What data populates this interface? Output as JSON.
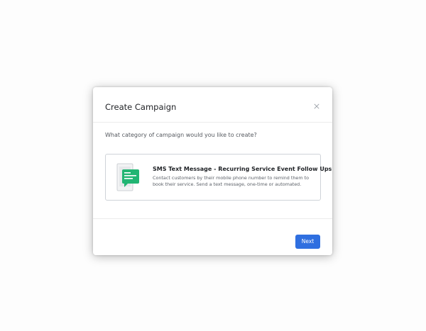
{
  "modal": {
    "title": "Create Campaign",
    "close_icon": "close-icon",
    "question": "What category of campaign would you like to create?",
    "options": [
      {
        "icon": "sms-message-icon",
        "icon_color": "#22b573",
        "title": "SMS Text Message - Recurring Service Event Follow Ups",
        "description": "Contact customers by their mobile phone number to remind them to book their service. Send a text message, one-time or automated."
      }
    ],
    "next_label": "Next"
  },
  "colors": {
    "primary_button": "#2f6fe0",
    "sms_green": "#22b573"
  }
}
